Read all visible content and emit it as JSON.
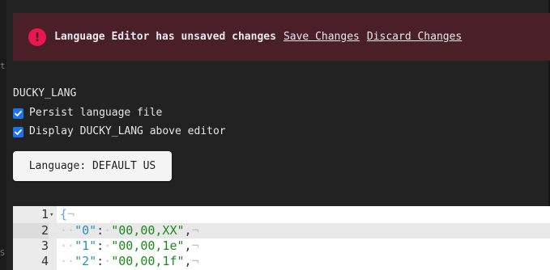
{
  "alert": {
    "icon": "alert-circle-icon",
    "message": "Language Editor has unsaved changes",
    "save_link": "Save Changes",
    "discard_link": "Discard Changes",
    "background": "#4a1f28",
    "icon_color": "#e8184f"
  },
  "settings": {
    "section_title": "DUCKY_LANG",
    "options": [
      {
        "label": "Persist language file",
        "checked": true
      },
      {
        "label": "Display DUCKY_LANG above editor",
        "checked": true
      }
    ],
    "language_button": "Language: DEFAULT US"
  },
  "editor": {
    "lines": [
      {
        "number": "1",
        "fold": "▾"
      },
      {
        "number": "2",
        "key": "\"0\"",
        "value": "\"00,00,XX\""
      },
      {
        "number": "3",
        "key": "\"1\"",
        "value": "\"00,00,1e\""
      },
      {
        "number": "4",
        "key": "\"2\"",
        "value": "\"00,00,1f\""
      }
    ],
    "open_brace": "{",
    "eol_marker": "¬",
    "ws_marker": "·",
    "colon": ":",
    "comma": ","
  },
  "gutter_marks": {
    "top": "t",
    "bottom": "S"
  }
}
